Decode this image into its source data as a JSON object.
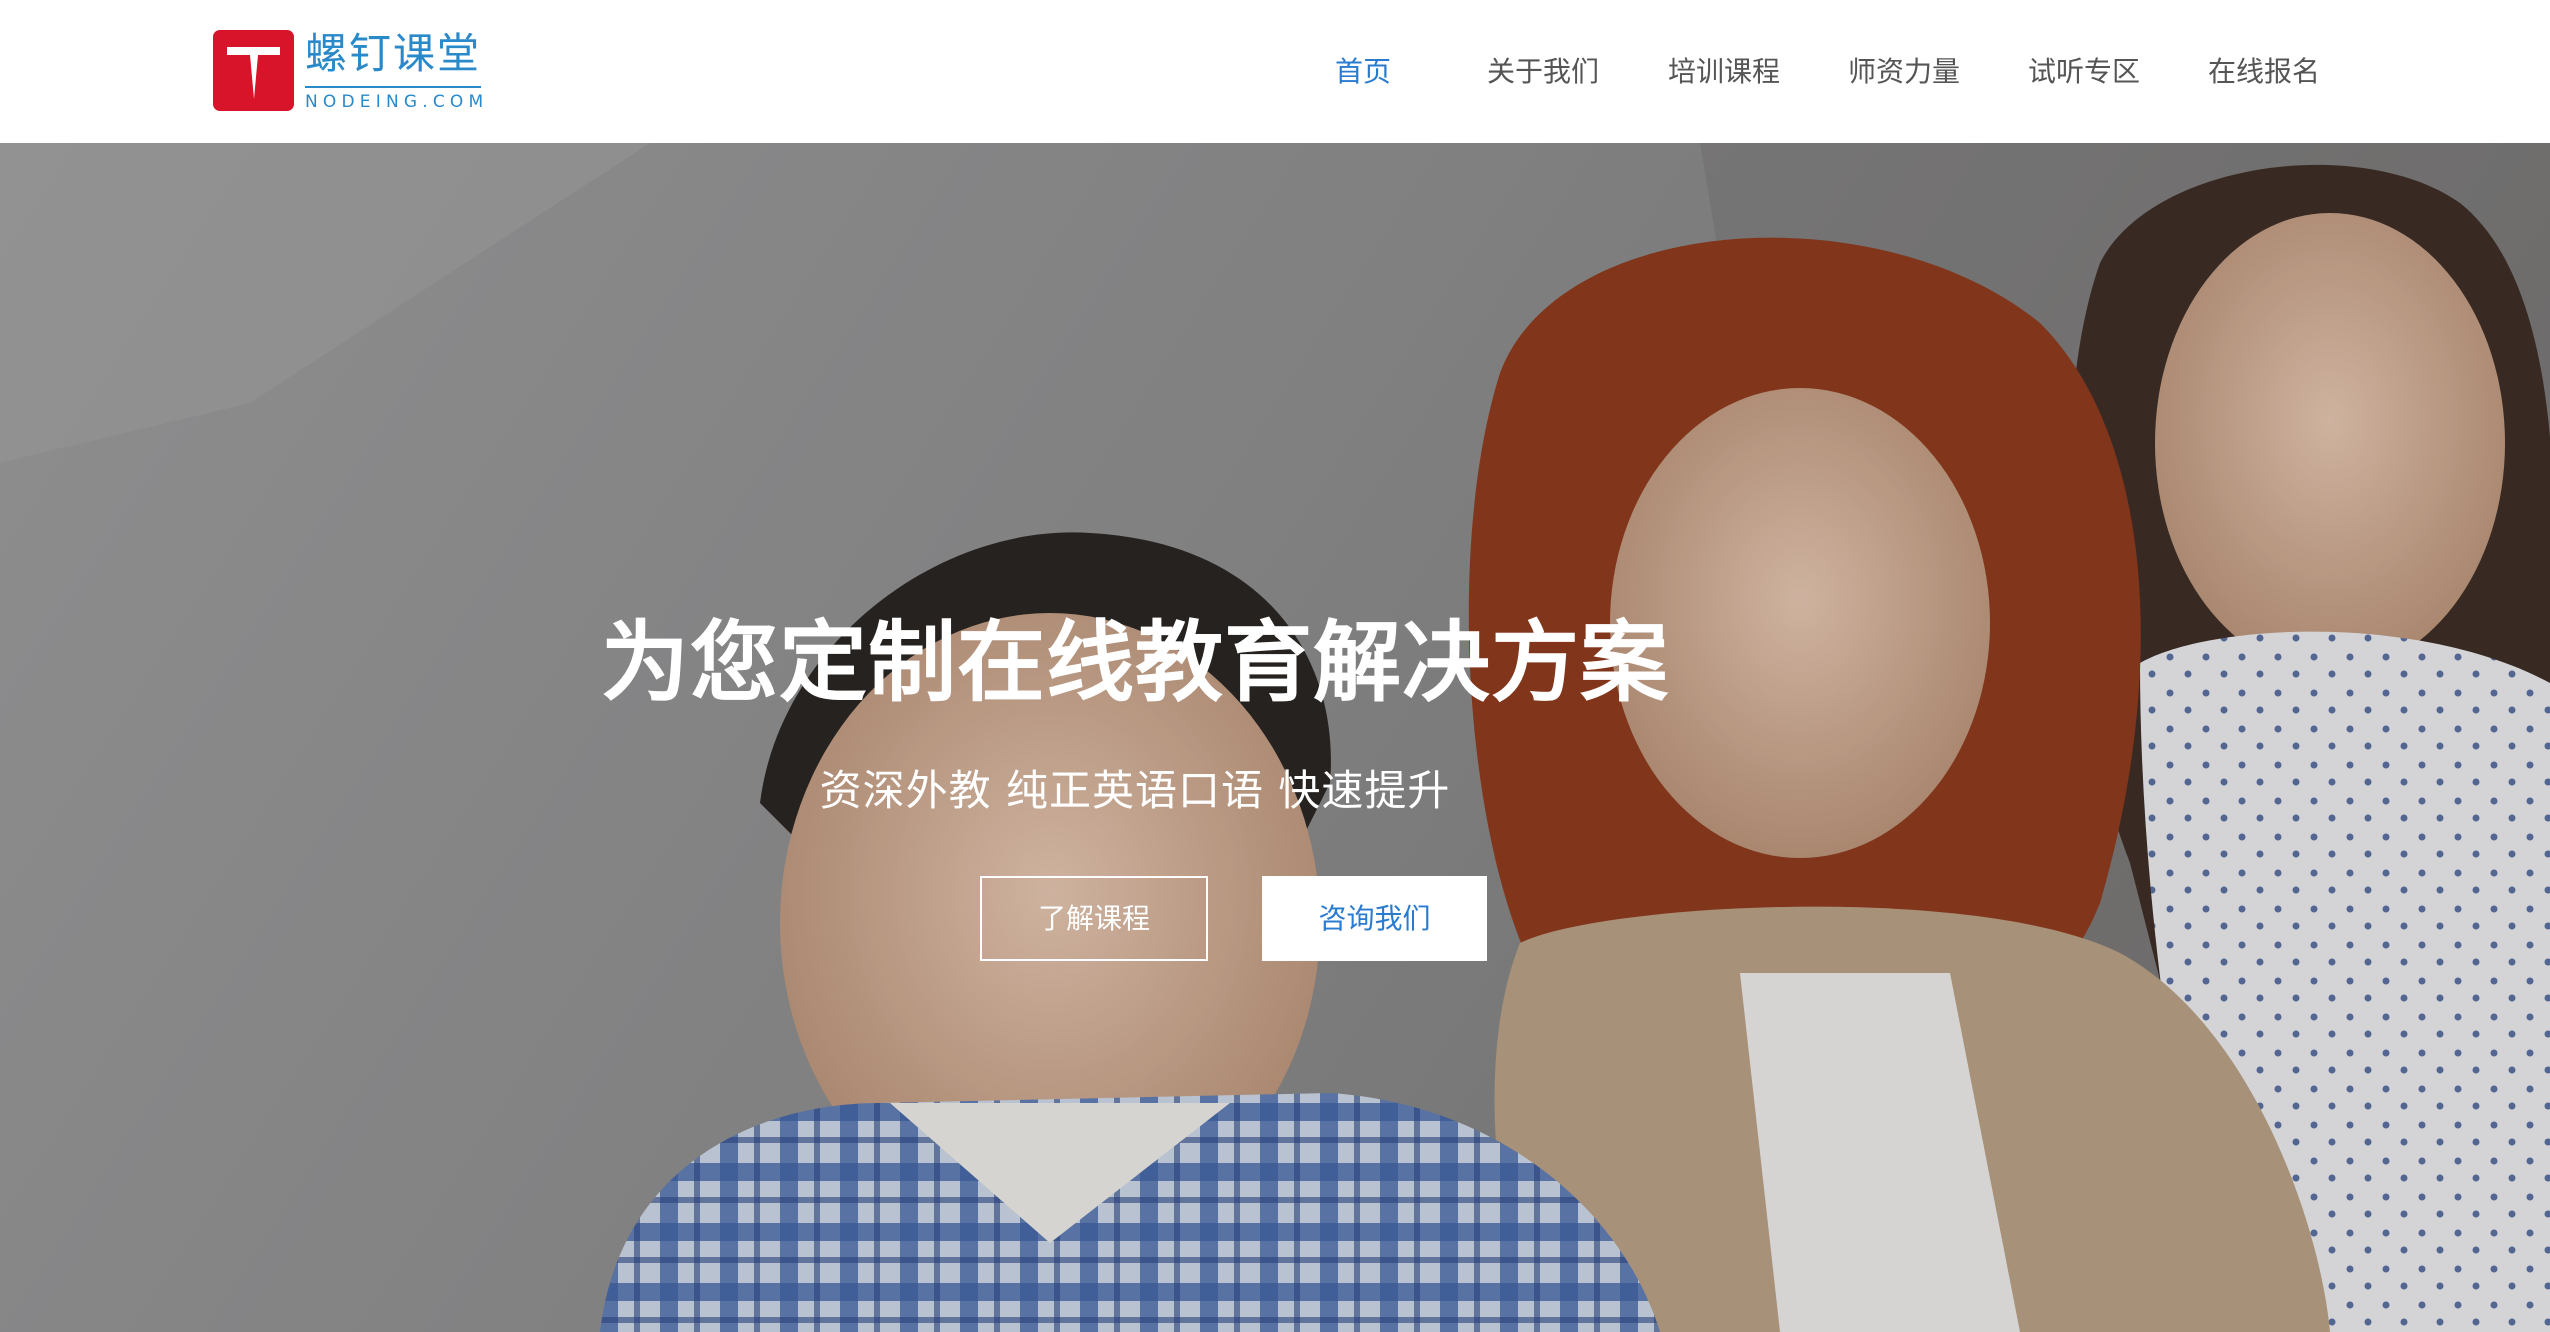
{
  "brand": {
    "name_cn": "螺钉课堂",
    "name_en": "NODEING.COM",
    "logo_icon": "t-nail-logo",
    "color_logo": "#d7142a",
    "color_text": "#2a89c9"
  },
  "nav": {
    "items": [
      {
        "label": "首页",
        "active": true
      },
      {
        "label": "关于我们",
        "active": false
      },
      {
        "label": "培训课程",
        "active": false
      },
      {
        "label": "师资力量",
        "active": false
      },
      {
        "label": "试听专区",
        "active": false
      },
      {
        "label": "在线报名",
        "active": false
      }
    ],
    "active_color": "#2a7bd0"
  },
  "hero": {
    "title": "为您定制在线教育解决方案",
    "subtitle": "资深外教  纯正英语口语  快速提升",
    "buttons": {
      "learn": "了解课程",
      "contact": "咨询我们"
    }
  }
}
